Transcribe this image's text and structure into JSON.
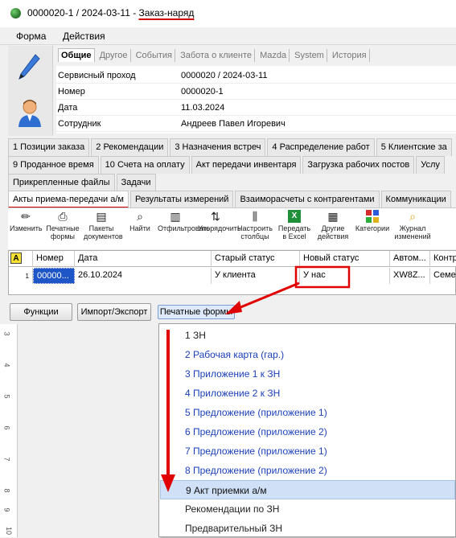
{
  "window": {
    "title_main": "0000020-1 / 2024-03-11 - ",
    "title_sub": "Заказ-наряд"
  },
  "menu": [
    "Форма",
    "Действия"
  ],
  "header_tabs": [
    "Общие",
    "Другое",
    "События",
    "Забота о клиенте",
    "Mazda",
    "System",
    "История"
  ],
  "header_fields": [
    {
      "label": "Сервисный проход",
      "value": "0000020 / 2024-03-11"
    },
    {
      "label": "Номер",
      "value": "0000020-1"
    },
    {
      "label": "Дата",
      "value": "11.03.2024"
    },
    {
      "label": "Сотрудник",
      "value": "Андреев Павел Игоревич"
    }
  ],
  "tabs_row1": [
    "1 Позиции заказа",
    "2 Рекомендации",
    "3 Назначения встреч",
    "4 Распределение работ",
    "5 Клиентские за"
  ],
  "tabs_row2": [
    "9 Проданное время",
    "10 Счета на оплату",
    "Акт передачи инвентаря",
    "Загрузка рабочих постов",
    "Услу"
  ],
  "tabs_row3": [
    "Прикрепленные файлы",
    "Задачи"
  ],
  "tabs_row4": [
    "Акты приема-передачи а/м",
    "Результаты измерений",
    "Взаиморасчеты с контрагентами",
    "Коммуникации"
  ],
  "toolbar": [
    {
      "icon": "pencil-icon",
      "label": "Изменить"
    },
    {
      "icon": "printer-icon",
      "label": "Печатные формы"
    },
    {
      "icon": "package-icon",
      "label": "Пакеты документов"
    },
    {
      "icon": "binoculars-icon",
      "label": "Найти"
    },
    {
      "icon": "filter-icon",
      "label": "Отфильтровать"
    },
    {
      "icon": "sort-icon",
      "label": "Упорядочить"
    },
    {
      "icon": "columns-icon",
      "label": "Настроить столбцы"
    },
    {
      "icon": "excel-icon",
      "label": "Передать в Excel"
    },
    {
      "icon": "actions-icon",
      "label": "Другие действия"
    },
    {
      "icon": "categories-icon",
      "label": "Категории"
    },
    {
      "icon": "journal-icon",
      "label": "Журнал изменений"
    }
  ],
  "grid": {
    "corner": "A",
    "columns": [
      "Номер",
      "Дата",
      "Старый статус",
      "Новый статус",
      "Автом...",
      "Контр"
    ],
    "row_index": "1",
    "row": [
      "00000...",
      "26.10.2024",
      "У клиента",
      "У нас",
      "XW8Z...",
      "Семе..."
    ]
  },
  "buttons": {
    "functions": "Функции",
    "import_export": "Импорт/Экспорт",
    "print_forms": "Печатные формы"
  },
  "ruler_numbers": [
    "3",
    "4",
    "5",
    "6",
    "7",
    "8",
    "9",
    "10"
  ],
  "dropdown": [
    {
      "label": "1 ЗН",
      "style": "link"
    },
    {
      "label": "2 Рабочая карта (гар.)",
      "style": "link"
    },
    {
      "label": "3 Приложение 1 к ЗН",
      "style": "link"
    },
    {
      "label": "4 Приложение 2 к ЗН",
      "style": "link"
    },
    {
      "label": "5 Предложение (приложение 1)",
      "style": "link"
    },
    {
      "label": "6 Предложение (приложение 2)",
      "style": "link"
    },
    {
      "label": "7 Предложение (приложение 1)",
      "style": "link"
    },
    {
      "label": "8 Предложение (приложение 2)",
      "style": "link"
    },
    {
      "label": "9 Акт приемки а/м",
      "style": "selected"
    },
    {
      "label": "Рекомендации по ЗН",
      "style": "plain"
    },
    {
      "label": "Предварительный ЗН",
      "style": "plain"
    }
  ],
  "colors": {
    "annotation_red": "#e00000",
    "link_blue": "#1a3fb8",
    "highlight": "#cfe0f7"
  }
}
